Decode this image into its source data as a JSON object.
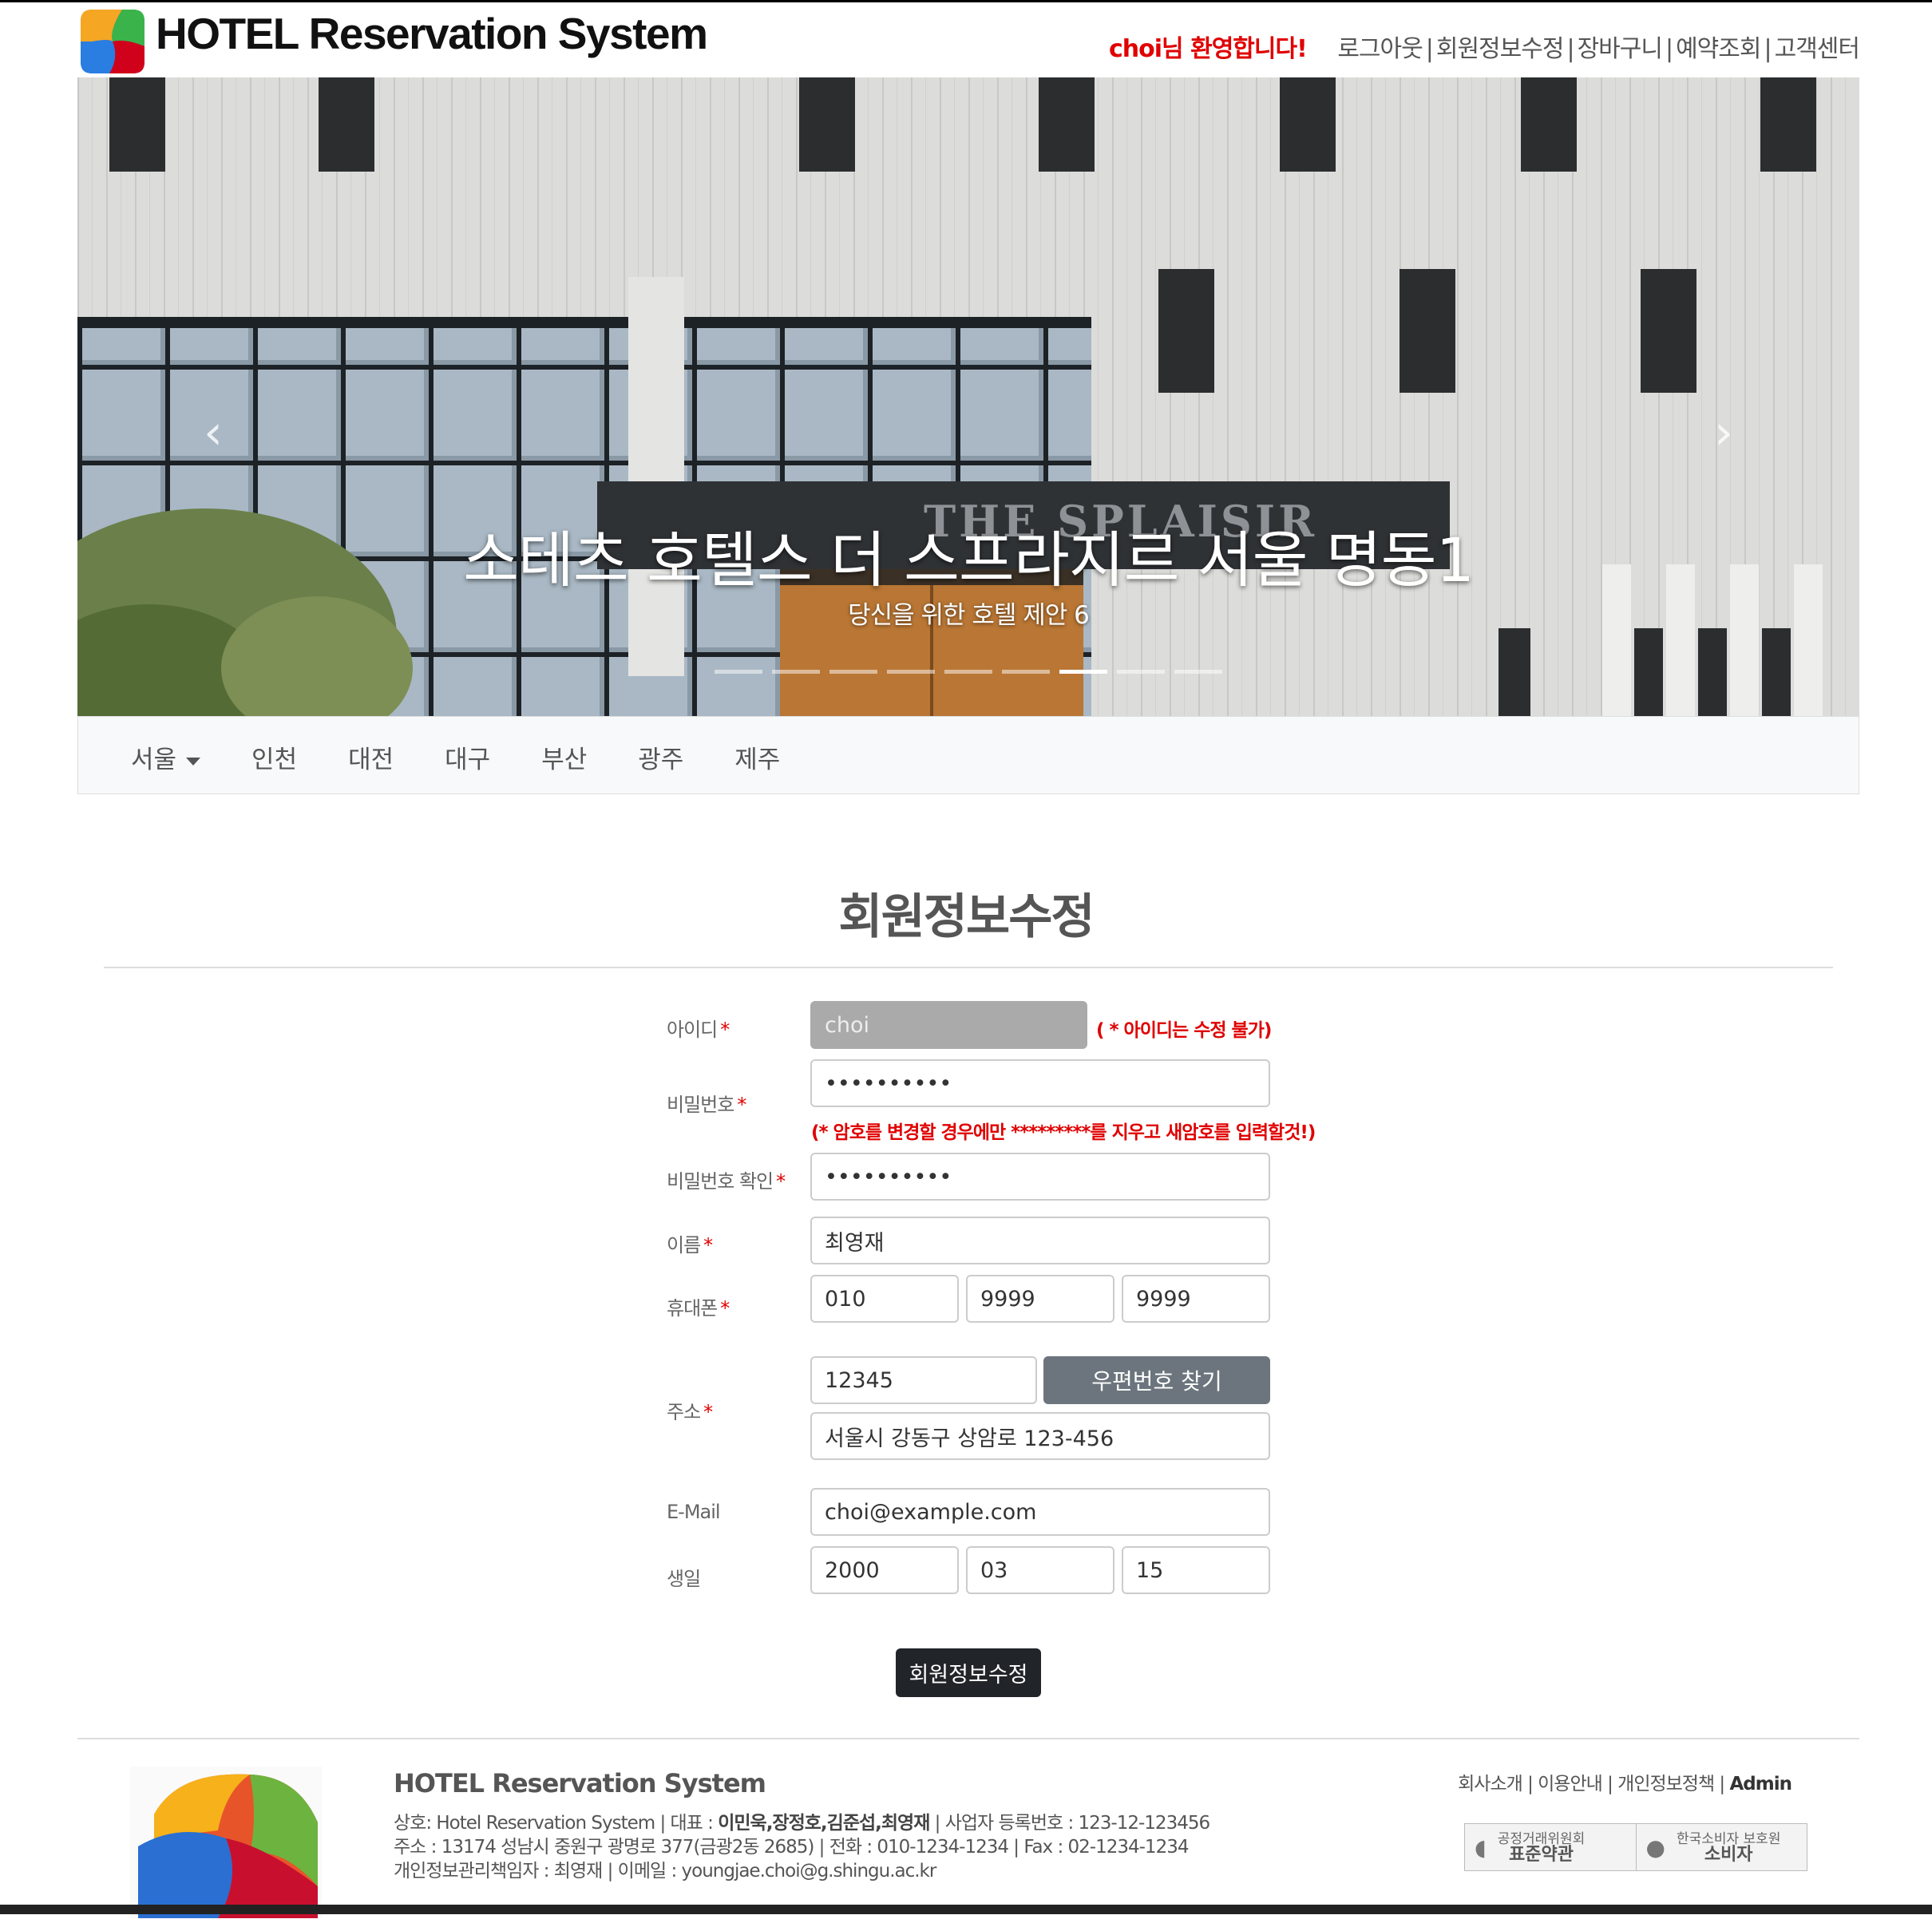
{
  "header": {
    "title": "HOTEL Reservation System",
    "welcome": "choi님 환영합니다!",
    "links": [
      "로그아웃",
      "회원정보수정",
      "장바구니",
      "예약조회",
      "고객센터"
    ]
  },
  "carousel": {
    "title": "소테츠 호텔스 더 스프라지르 서울 명동1",
    "subtitle": "당신을 위한 호텔 제안 6",
    "sign_text": "THE SPLAISIR",
    "slide_count": 9,
    "active_slide": 7,
    "prev_icon": "chevron-left-icon",
    "next_icon": "chevron-right-icon"
  },
  "nav": {
    "cities": [
      "서울",
      "인천",
      "대전",
      "대구",
      "부산",
      "광주",
      "제주"
    ]
  },
  "form": {
    "title": "회원정보수정",
    "id": {
      "label": "아이디",
      "value": "choi",
      "note": "( * 아이디는 수정 불가)"
    },
    "password": {
      "label": "비밀번호",
      "value": "••••••••••",
      "note": "(* 암호를 변경할 경우에만 *********를 지우고 새암호를 입력할것!)"
    },
    "password_confirm": {
      "label": "비밀번호 확인",
      "value": "••••••••••"
    },
    "name": {
      "label": "이름",
      "value": "최영재"
    },
    "phone": {
      "label": "휴대폰",
      "values": [
        "010",
        "9999",
        "9999"
      ]
    },
    "address": {
      "label": "주소",
      "zip": "12345",
      "zip_button": "우편번호 찾기",
      "address": "서울시 강동구 상암로 123-456"
    },
    "email": {
      "label": "E-Mail",
      "value": "choi@example.com"
    },
    "birth": {
      "label": "생일",
      "values": [
        "2000",
        "03",
        "15"
      ]
    },
    "required_mark": "*",
    "submit": "회원정보수정"
  },
  "footer": {
    "name": "HOTEL Reservation System",
    "line1_prefix": "상호: Hotel Reservation System | 대표 : ",
    "line1_reps": "이민욱,장정호,김준섭,최영재",
    "line1_suffix": " | 사업자 등록번호 : 123-12-123456",
    "line2": "주소 : 13174 성남시 중원구 광명로 377(금광2동 2685) | 전화 : 010-1234-1234 | Fax : 02-1234-1234",
    "line3": "개인정보관리책임자 : 최영재 | 이메일 : youngjae.choi@g.shingu.ac.kr",
    "links": [
      "회사소개",
      "이용안내",
      "개인정보정책"
    ],
    "admin": "Admin",
    "badge1_top": "공정거래위원회",
    "badge1_bottom": "표준약관",
    "badge2_top": "한국소비자 보호원",
    "badge2_bottom": "소비자"
  },
  "colors": {
    "accent_red": "#e00000",
    "zip_button": "#6c757d",
    "submit_button": "#212529",
    "nav_bg": "#f8f9fa"
  }
}
